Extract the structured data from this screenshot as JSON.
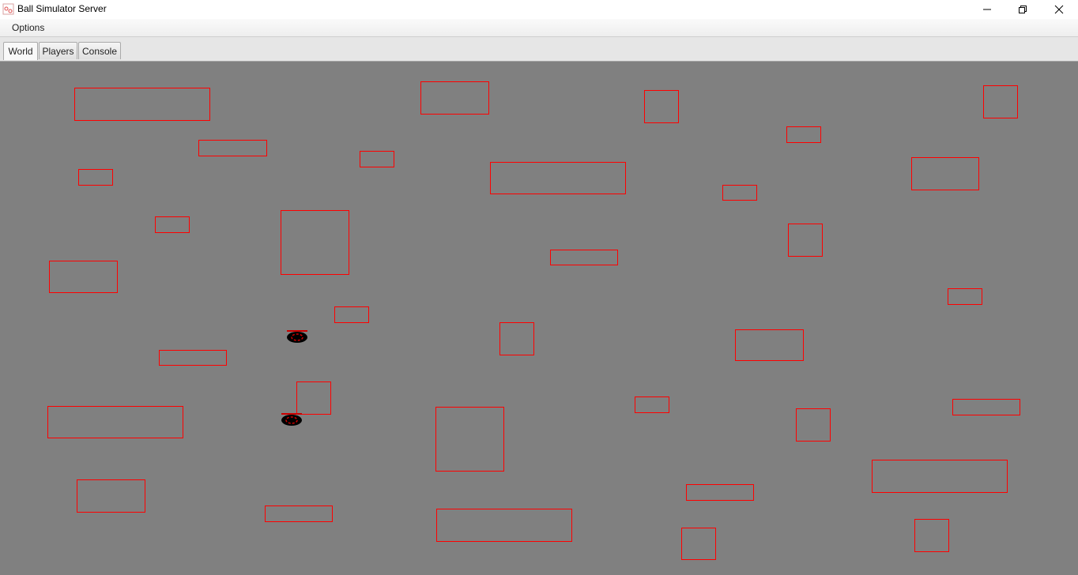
{
  "window": {
    "title": "Ball Simulator Server"
  },
  "menu": {
    "options_label": "Options"
  },
  "tabs": [
    {
      "label": "World",
      "active": true
    },
    {
      "label": "Players",
      "active": false
    },
    {
      "label": "Console",
      "active": false
    }
  ],
  "colors": {
    "world_background": "#808080",
    "obstacle_outline": "#ff0000",
    "ball_fill": "#000000",
    "ball_marking": "#cc0000"
  },
  "icons": {
    "app": "ball-simulator-app-icon",
    "minimize": "minimize-icon",
    "maximize": "restore-icon",
    "close": "close-icon"
  }
}
